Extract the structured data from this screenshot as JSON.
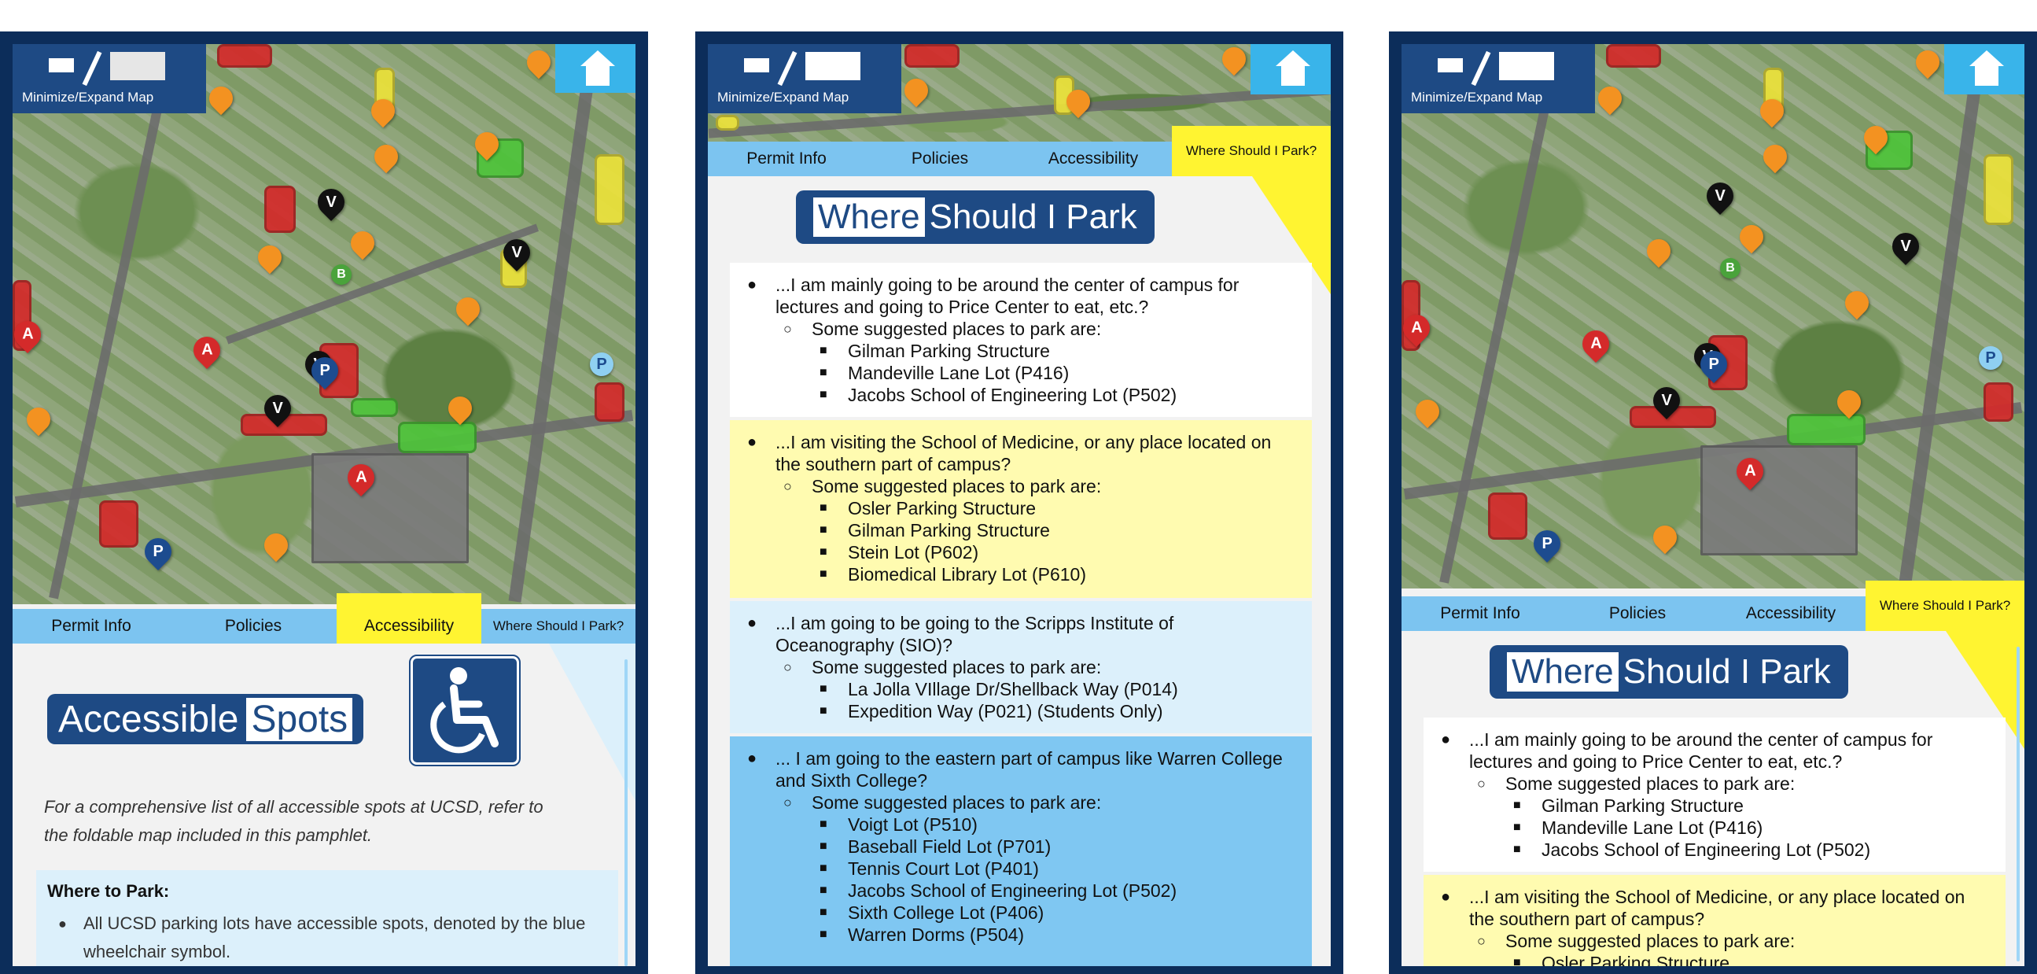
{
  "shared": {
    "minimize_label": "Minimize/Expand Map",
    "tabs": [
      "Permit Info",
      "Policies",
      "Accessibility",
      "Where Should I Park?"
    ],
    "colors": {
      "navy": "#0c2d5a",
      "brand_blue": "#1e4a84",
      "tab_blue": "#7cc4f0",
      "active_yellow": "#fff431",
      "light_blue": "#dcf0fb",
      "pale_yellow": "#fffbb0",
      "mid_blue": "#7fc7f2"
    },
    "icons": {
      "home": "home-icon",
      "minimize": "minimize-expand-icon",
      "wheelchair": "wheelchair-icon"
    }
  },
  "panel1": {
    "active_tab": "Accessibility",
    "title_part1": "Accessible",
    "title_part2": "Spots",
    "note": "For a comprehensive list of all accessible spots at UCSD, refer to the foldable map included in this pamphlet.",
    "where_heading": "Where to Park:",
    "where_items": [
      "All UCSD parking lots have accessible spots, denoted by the blue wheelchair symbol."
    ]
  },
  "panel2": {
    "active_tab": "Where Should I Park?",
    "title_part1": "Where",
    "title_part2": "Should I Park",
    "sections": [
      {
        "question": "...I am mainly going to be around the center of campus for lectures and going to Price Center to eat, etc.?",
        "sub": "Some suggested places to park are:",
        "items": [
          "Gilman Parking Structure",
          "Mandeville Lane Lot (P416)",
          "Jacobs School of Engineering Lot (P502)"
        ]
      },
      {
        "question": " ...I am visiting the School of Medicine, or any place located on the southern part of campus?",
        "sub": "Some suggested places to park are:",
        "items": [
          "Osler Parking Structure",
          "Gilman Parking Structure",
          "Stein Lot (P602)",
          "Biomedical Library Lot (P610)"
        ]
      },
      {
        "question": "...I am going to be going to the Scripps Institute of Oceanography (SIO)?",
        "sub": "Some suggested places to park are:",
        "items": [
          "La Jolla VIllage Dr/Shellback Way (P014)",
          "Expedition Way (P021) (Students Only)"
        ]
      },
      {
        "question": "... I am going to the eastern part of campus like Warren College and Sixth College?",
        "sub": "Some suggested places to park are:",
        "items": [
          "Voigt Lot (P510)",
          "Baseball Field Lot (P701)",
          "Tennis Court Lot (P401)",
          "Jacobs School of Engineering Lot (P502)",
          "Sixth College Lot (P406)",
          "Warren Dorms (P504)"
        ]
      }
    ]
  },
  "panel3": {
    "active_tab": "Where Should I Park?",
    "title_part1": "Where",
    "title_part2": "Should I Park",
    "sections": [
      {
        "question": "...I am mainly going to be around the center of campus for lectures and going to Price Center to eat, etc.?",
        "sub": "Some suggested places to park are:",
        "items": [
          "Gilman Parking Structure",
          "Mandeville Lane Lot (P416)",
          "Jacobs School of Engineering Lot (P502)"
        ]
      },
      {
        "question": " ...I am visiting the School of Medicine, or any place located on the southern part of campus?",
        "sub": "Some suggested places to park are:",
        "items": [
          "Osler Parking Structure"
        ]
      }
    ]
  },
  "map_markers": {
    "visitor": "V",
    "accessible": "A",
    "permit": "P",
    "bike": "B"
  }
}
